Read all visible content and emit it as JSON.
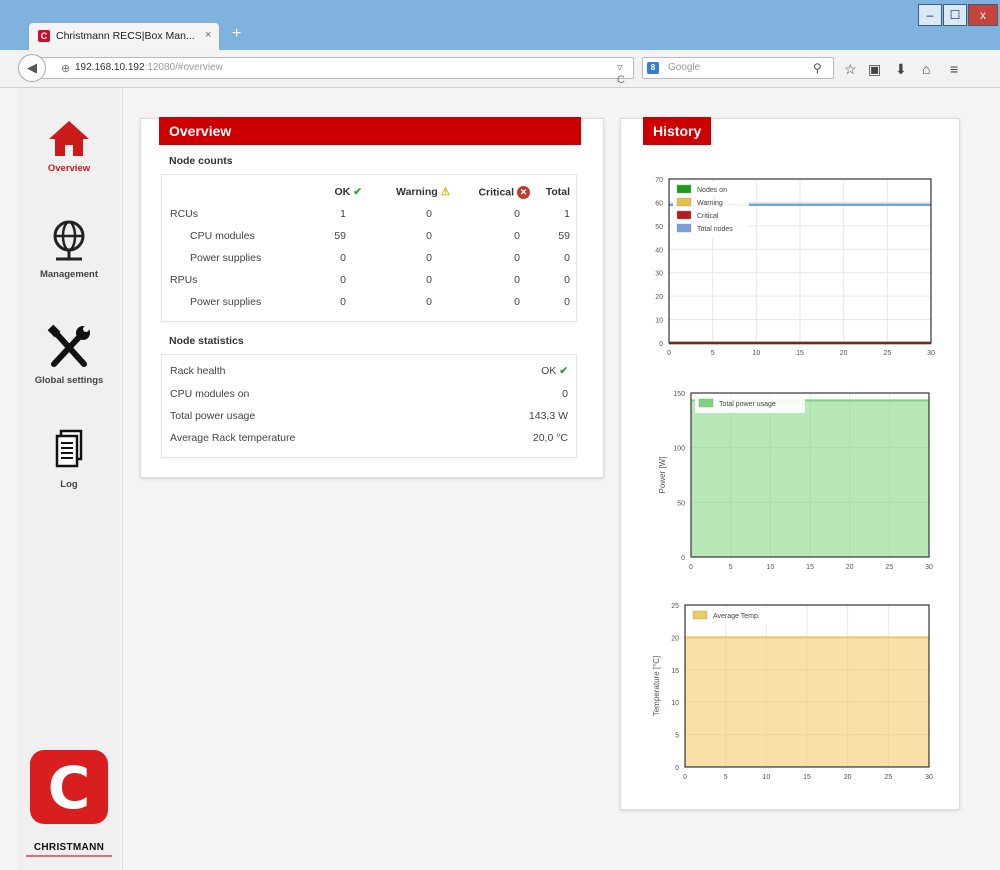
{
  "browser": {
    "tab_title": "Christmann RECS|Box Man...",
    "tab_close": "×",
    "new_tab": "+",
    "url_host": "192.168.10.192",
    "url_rest": ":12080/#overview",
    "search_engine": "8",
    "search_placeholder": "Google",
    "window_buttons": [
      "–",
      "☐",
      "x"
    ]
  },
  "sidebar": {
    "items": [
      {
        "label": "Overview",
        "icon": "home-icon",
        "active": true
      },
      {
        "label": "Management",
        "icon": "globe-icon",
        "active": false
      },
      {
        "label": "Global settings",
        "icon": "tools-icon",
        "active": false
      },
      {
        "label": "Log",
        "icon": "document-icon",
        "active": false
      }
    ],
    "logo_letter": "C",
    "logo_text": "CHRISTMANN"
  },
  "overview": {
    "title": "Overview",
    "node_counts_title": "Node counts",
    "columns": [
      "OK",
      "Warning",
      "Critical",
      "Total"
    ],
    "rows": [
      {
        "label": "RCUs",
        "indent": false,
        "ok": "1",
        "warning": "0",
        "critical": "0",
        "total": "1"
      },
      {
        "label": "CPU modules",
        "indent": true,
        "ok": "59",
        "warning": "0",
        "critical": "0",
        "total": "59"
      },
      {
        "label": "Power supplies",
        "indent": true,
        "ok": "0",
        "warning": "0",
        "critical": "0",
        "total": "0"
      },
      {
        "label": "RPUs",
        "indent": false,
        "ok": "0",
        "warning": "0",
        "critical": "0",
        "total": "0"
      },
      {
        "label": "Power supplies",
        "indent": true,
        "ok": "0",
        "warning": "0",
        "critical": "0",
        "total": "0"
      }
    ],
    "node_statistics_title": "Node statistics",
    "stats": [
      {
        "label": "Rack health",
        "value": "OK",
        "check": true
      },
      {
        "label": "CPU modules on",
        "value": "0"
      },
      {
        "label": "Total power usage",
        "value": "143,3 W"
      },
      {
        "label": "Average Rack temperature",
        "value": "20,0 °C"
      }
    ]
  },
  "history": {
    "title": "History"
  },
  "colors": {
    "accent": "#cc0000",
    "nodes_on": "#1a9e1a",
    "warning": "#e6c04a",
    "critical": "#b71c1c",
    "total_nodes": "#7a9fd8",
    "power": "#7ed37e",
    "temp": "#f0c860"
  },
  "chart_data": [
    {
      "type": "line",
      "title": "",
      "xlabel": "",
      "ylabel": "",
      "xlim": [
        0,
        30
      ],
      "ylim": [
        0,
        70
      ],
      "xticks": [
        0,
        5,
        10,
        15,
        20,
        25,
        30
      ],
      "yticks": [
        0,
        10,
        20,
        30,
        40,
        50,
        60,
        70
      ],
      "legend_position": "top-left",
      "series": [
        {
          "name": "Nodes on",
          "color": "#1a9e1a",
          "x": [
            0,
            30
          ],
          "values": [
            0,
            0
          ]
        },
        {
          "name": "Warning",
          "color": "#e6c04a",
          "x": [
            0,
            30
          ],
          "values": [
            0,
            0
          ]
        },
        {
          "name": "Critical",
          "color": "#b71c1c",
          "x": [
            0,
            30
          ],
          "values": [
            0,
            0
          ]
        },
        {
          "name": "Total nodes",
          "color": "#7a9fd8",
          "x": [
            0,
            30
          ],
          "values": [
            59,
            59
          ]
        }
      ]
    },
    {
      "type": "area",
      "title": "",
      "xlabel": "",
      "ylabel": "Power [W]",
      "xlim": [
        0,
        30
      ],
      "ylim": [
        0,
        150
      ],
      "xticks": [
        0,
        5,
        10,
        15,
        20,
        25,
        30
      ],
      "yticks": [
        0,
        50,
        100,
        150
      ],
      "legend_position": "top-left",
      "series": [
        {
          "name": "Total power usage",
          "color": "#7ed37e",
          "x": [
            0,
            30
          ],
          "values": [
            143.3,
            143.3
          ]
        }
      ]
    },
    {
      "type": "area",
      "title": "",
      "xlabel": "",
      "ylabel": "Temperature [°C]",
      "xlim": [
        0,
        30
      ],
      "ylim": [
        0,
        25
      ],
      "xticks": [
        0,
        5,
        10,
        15,
        20,
        25,
        30
      ],
      "yticks": [
        0,
        5,
        10,
        15,
        20,
        25
      ],
      "legend_position": "top-left",
      "series": [
        {
          "name": "Average Temp.",
          "color": "#f0c860",
          "x": [
            0,
            30
          ],
          "values": [
            20,
            20
          ]
        }
      ]
    }
  ]
}
